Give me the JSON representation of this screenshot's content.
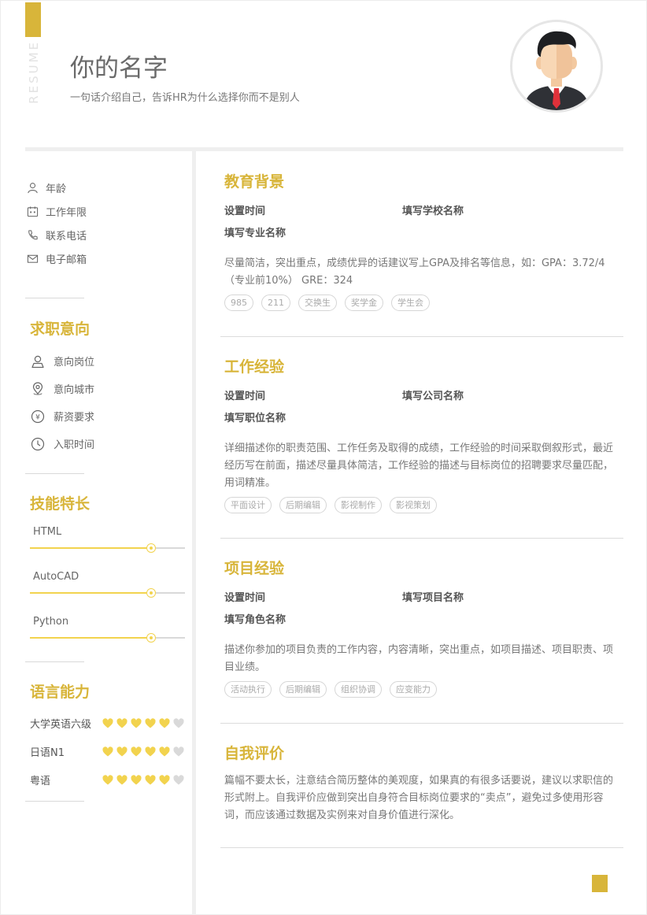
{
  "header": {
    "vertical_label": "RESUME",
    "name": "你的名字",
    "tagline": "一句话介绍自己，告诉HR为什么选择你而不是别人"
  },
  "basic_info": [
    {
      "label": "年龄",
      "icon": "person-icon"
    },
    {
      "label": "工作年限",
      "icon": "calendar-icon"
    },
    {
      "label": "联系电话",
      "icon": "phone-icon"
    },
    {
      "label": "电子邮箱",
      "icon": "mail-icon"
    }
  ],
  "job_intent": {
    "title": "求职意向",
    "items": [
      {
        "label": "意向岗位",
        "icon": "user-icon"
      },
      {
        "label": "意向城市",
        "icon": "location-icon"
      },
      {
        "label": "薪资要求",
        "icon": "yen-icon"
      },
      {
        "label": "入职时间",
        "icon": "clock-icon"
      }
    ]
  },
  "skills": {
    "title": "技能特长",
    "items": [
      {
        "name": "HTML",
        "level": 0.78
      },
      {
        "name": "AutoCAD",
        "level": 0.78
      },
      {
        "name": "Python",
        "level": 0.78
      }
    ]
  },
  "languages": {
    "title": "语言能力",
    "items": [
      {
        "name": "大学英语六级",
        "rating": 5,
        "max": 6
      },
      {
        "name": "日语N1",
        "rating": 5,
        "max": 6
      },
      {
        "name": "粤语",
        "rating": 5,
        "max": 6
      }
    ]
  },
  "education": {
    "title": "教育背景",
    "time": "设置时间",
    "org": "填写学校名称",
    "role": "填写专业名称",
    "desc": "尽量简洁，突出重点，成绩优异的话建议写上GPA及排名等信息，如：GPA：3.72/4（专业前10%） GRE：324",
    "tags": [
      "985",
      "211",
      "交换生",
      "奖学金",
      "学生会"
    ]
  },
  "work": {
    "title": "工作经验",
    "time": "设置时间",
    "org": "填写公司名称",
    "role": "填写职位名称",
    "desc": "详细描述你的职责范围、工作任务及取得的成绩，工作经验的时间采取倒叙形式，最近经历写在前面，描述尽量具体简洁，工作经验的描述与目标岗位的招聘要求尽量匹配，用词精准。",
    "tags": [
      "平面设计",
      "后期编辑",
      "影视制作",
      "影视策划"
    ]
  },
  "project": {
    "title": "项目经验",
    "time": "设置时间",
    "org": "填写项目名称",
    "role": "填写角色名称",
    "desc": "描述你参加的项目负责的工作内容，内容清晰，突出重点，如项目描述、项目职责、项目业绩。",
    "tags": [
      "活动执行",
      "后期编辑",
      "组织协调",
      "应变能力"
    ]
  },
  "self_eval": {
    "title": "自我评价",
    "desc": "篇幅不要太长，注意结合简历整体的美观度，如果真的有很多话要说，建议以求职信的形式附上。自我评价应做到突出自身符合目标岗位要求的“卖点”，避免过多使用形容词，而应该通过数据及实例来对自身价值进行深化。"
  },
  "colors": {
    "accent": "#d8b53a",
    "bar": "#f2d34e",
    "heart_on": "#f2d34e",
    "heart_off": "#d9d9d9"
  }
}
